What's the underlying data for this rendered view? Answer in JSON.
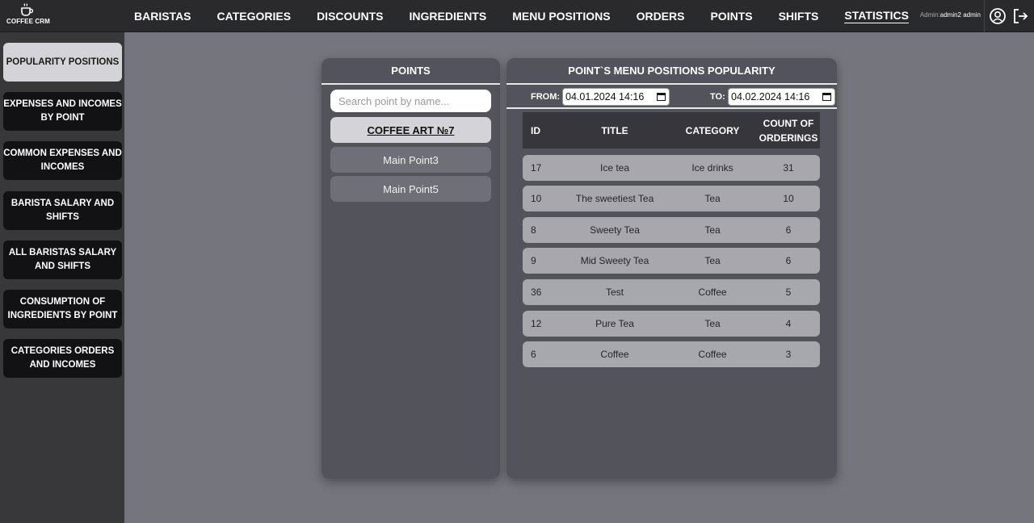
{
  "app": {
    "title": "COFFEE CRM"
  },
  "nav": {
    "items": [
      "BARISTAS",
      "CATEGORIES",
      "DISCOUNTS",
      "INGREDIENTS",
      "MENU POSITIONS",
      "ORDERS",
      "POINTS",
      "SHIFTS",
      "STATISTICS"
    ],
    "active": "STATISTICS"
  },
  "user": {
    "label": "Admin:",
    "name": "admin2 admin"
  },
  "sidebar": {
    "items": [
      "POPULARITY POSITIONS",
      "EXPENSES AND INCOMES BY POINT",
      "COMMON EXPENSES AND INCOMES",
      "BARISTA SALARY AND SHIFTS",
      "ALL BARISTAS SALARY AND SHIFTS",
      "CONSUMPTION OF INGREDIENTS BY POINT",
      "CATEGORIES ORDERS AND INCOMES"
    ],
    "active": "POPULARITY POSITIONS"
  },
  "points_panel": {
    "title": "POINTS",
    "search_placeholder": "Search point by name...",
    "points": [
      "COFFEE ART №7",
      "Main Point3",
      "Main Point5"
    ],
    "selected": "COFFEE ART №7"
  },
  "popularity_panel": {
    "title": "POINT`S MENU POSITIONS POPULARITY",
    "from_label": "FROM:",
    "from_value": "04.01.2024 14:16",
    "to_label": "TO:",
    "to_value": "04.02.2024 14:16",
    "columns": [
      "ID",
      "TITLE",
      "CATEGORY",
      "COUNT OF ORDERINGS"
    ],
    "rows": [
      {
        "id": "17",
        "title": "Ice tea",
        "category": "Ice drinks",
        "count": "31"
      },
      {
        "id": "10",
        "title": "The sweetiest Tea",
        "category": "Tea",
        "count": "10"
      },
      {
        "id": "8",
        "title": "Sweety Tea",
        "category": "Tea",
        "count": "6"
      },
      {
        "id": "9",
        "title": "Mid Sweety Tea",
        "category": "Tea",
        "count": "6"
      },
      {
        "id": "36",
        "title": "Test",
        "category": "Coffee",
        "count": "5"
      },
      {
        "id": "12",
        "title": "Pure Tea",
        "category": "Tea",
        "count": "4"
      },
      {
        "id": "6",
        "title": "Coffee",
        "category": "Coffee",
        "count": "3"
      }
    ]
  },
  "icons": {
    "logo": "coffee-cup-icon",
    "profile": "user-circle-icon",
    "logout": "logout-icon",
    "calendar": "calendar-icon"
  }
}
